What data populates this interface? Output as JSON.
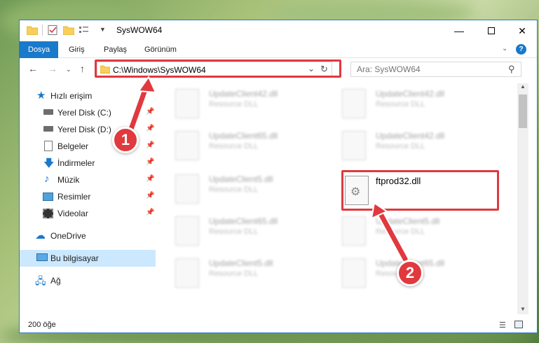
{
  "window": {
    "title": "SysWOW64"
  },
  "ribbon": {
    "tabs": [
      {
        "label": "Dosya"
      },
      {
        "label": "Giriş"
      },
      {
        "label": "Paylaş"
      },
      {
        "label": "Görünüm"
      }
    ]
  },
  "navbar": {
    "address": "C:\\Windows\\SysWOW64",
    "search_placeholder": "Ara: SysWOW64"
  },
  "sidebar": {
    "items": [
      {
        "label": "Hızlı erişim",
        "icon": "star-icon"
      },
      {
        "label": "Yerel Disk (C:)",
        "icon": "drive-icon",
        "pinned": true
      },
      {
        "label": "Yerel Disk (D:)",
        "icon": "drive-icon",
        "pinned": true
      },
      {
        "label": "Belgeler",
        "icon": "documents-icon",
        "pinned": true
      },
      {
        "label": "İndirmeler",
        "icon": "download-icon",
        "pinned": true
      },
      {
        "label": "Müzik",
        "icon": "music-icon",
        "pinned": true
      },
      {
        "label": "Resimler",
        "icon": "pictures-icon",
        "pinned": true
      },
      {
        "label": "Videolar",
        "icon": "videos-icon",
        "pinned": true
      },
      {
        "label": "OneDrive",
        "icon": "cloud-icon"
      },
      {
        "label": "Bu bilgisayar",
        "icon": "computer-icon",
        "selected": true
      },
      {
        "label": "Ağ",
        "icon": "network-icon"
      }
    ]
  },
  "files": [
    {
      "name": "UpdateClient42.dll",
      "type": "Resource DLL"
    },
    {
      "name": "UpdateClient42.dll",
      "type": "Resource DLL"
    },
    {
      "name": "UpdateClient65.dll",
      "type": "Resource DLL"
    },
    {
      "name": "UpdateClient42.dll",
      "type": "Resource DLL"
    },
    {
      "name": "UpdateClient5.dll",
      "type": "Resource DLL"
    },
    {
      "name": "UpdateClient65.dll",
      "type": "Resource DLL"
    },
    {
      "name": "UpdateClient5.dll",
      "type": "Resource DLL"
    },
    {
      "name": "UpdateClient5.dll",
      "type": "Resource DLL"
    },
    {
      "name": "UpdateClient65.dll",
      "type": "Resource DLL"
    }
  ],
  "target_file": {
    "name": "ftprod32.dll"
  },
  "status": {
    "count": "200 öğe"
  },
  "annotations": {
    "step1": "1",
    "step2": "2"
  },
  "colors": {
    "accent": "#1979ca",
    "highlight": "#e0393e"
  }
}
